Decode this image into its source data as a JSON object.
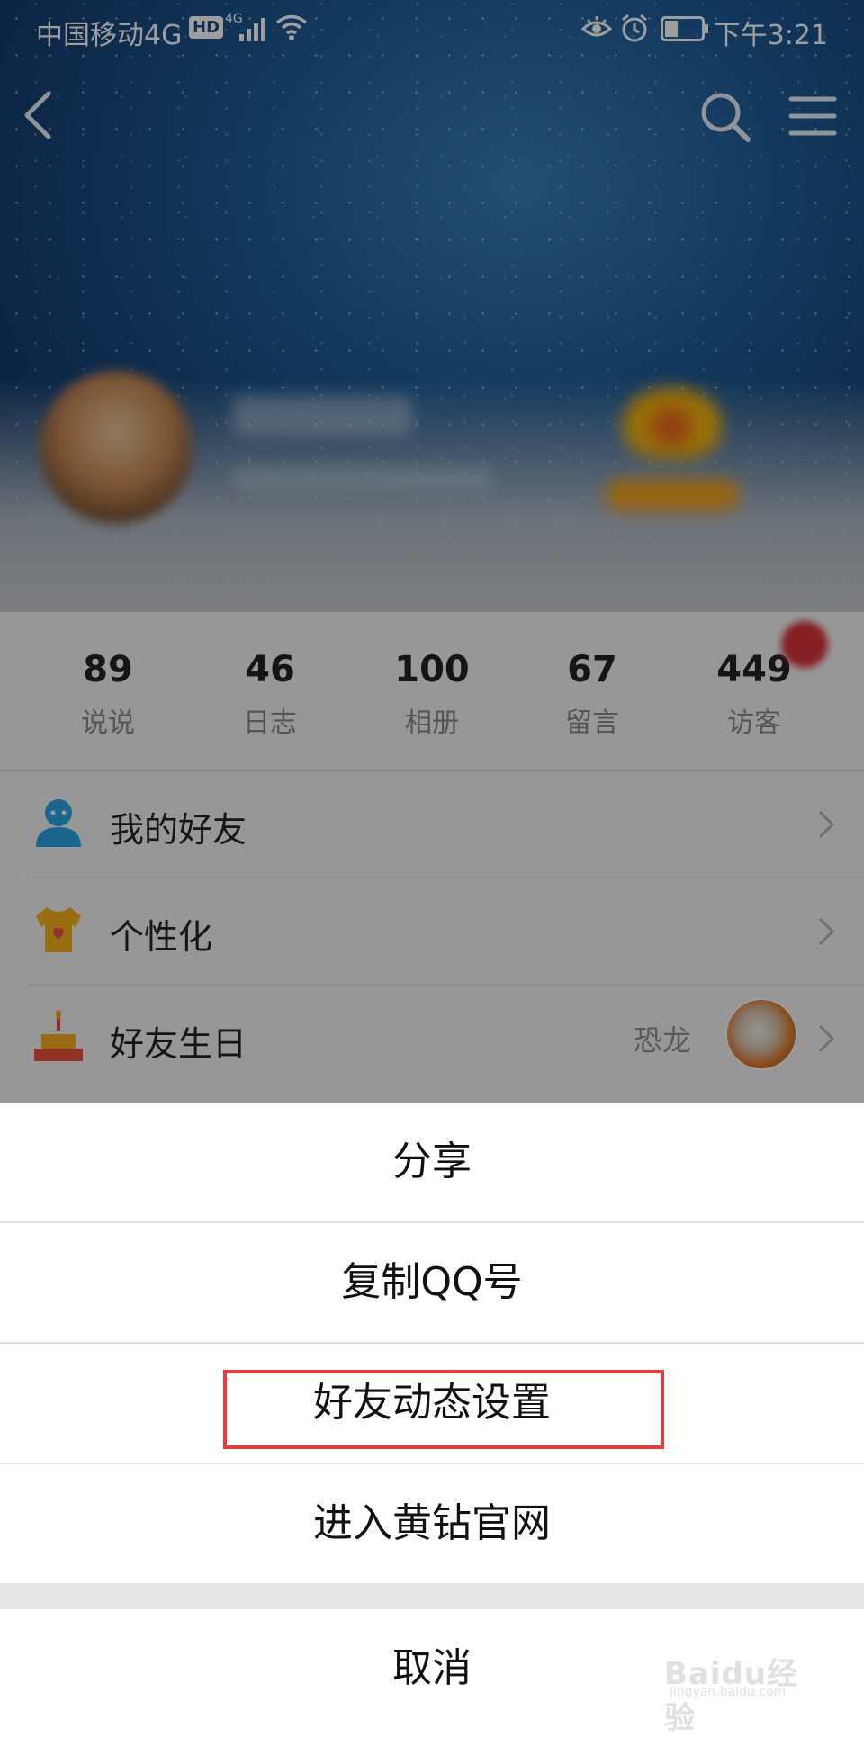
{
  "status_bar": {
    "carrier": "中国移动4G",
    "hd": "HD",
    "network": "4G",
    "time": "下午3:21"
  },
  "profile": {
    "stats": [
      {
        "value": "89",
        "label": "说说"
      },
      {
        "value": "46",
        "label": "日志"
      },
      {
        "value": "100",
        "label": "相册"
      },
      {
        "value": "67",
        "label": "留言"
      },
      {
        "value": "449",
        "label": "访客"
      }
    ],
    "menu": [
      {
        "label": "我的好友",
        "icon": "friend-icon"
      },
      {
        "label": "个性化",
        "icon": "tshirt-icon"
      },
      {
        "label": "好友生日",
        "icon": "cake-icon",
        "extra": "恐龙"
      }
    ]
  },
  "action_sheet": {
    "items": [
      "分享",
      "复制QQ号",
      "好友动态设置",
      "进入黄钻官网"
    ],
    "cancel": "取消",
    "highlight_color": "#e33d3f"
  },
  "watermark": {
    "text": "Baidu经验",
    "sub": "jingyan.baidu.com"
  }
}
